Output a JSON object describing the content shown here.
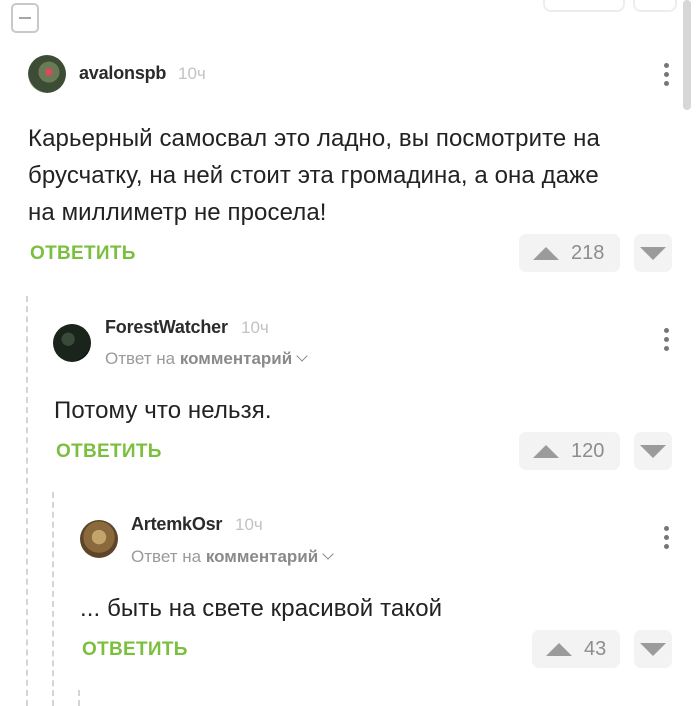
{
  "collapse_icon": "minus-square-icon",
  "comments": [
    {
      "author": "avalonspb",
      "time": "10ч",
      "text_lines": [
        "Карьерный самосвал это ладно, вы посмотрите на",
        "брусчатку, на ней стоит эта громадина, а она даже",
        "на миллиметр не просела!"
      ],
      "reply_label": "ОТВЕТИТЬ",
      "rating": "218"
    },
    {
      "author": "ForestWatcher",
      "time": "10ч",
      "reply_to_prefix": "Ответ на",
      "reply_to_target": "комментарий",
      "text_lines": [
        "Потому что нельзя."
      ],
      "reply_label": "ОТВЕТИТЬ",
      "rating": "120"
    },
    {
      "author": "ArtemkOsr",
      "time": "10ч",
      "reply_to_prefix": "Ответ на",
      "reply_to_target": "комментарий",
      "text_lines": [
        "... быть на свете красивой такой"
      ],
      "reply_label": "ОТВЕТИТЬ",
      "rating": "43"
    }
  ],
  "colors": {
    "accent_green": "#7bbf3e",
    "muted_gray": "#9a9a9a",
    "vote_bg": "#f3f3f3"
  }
}
